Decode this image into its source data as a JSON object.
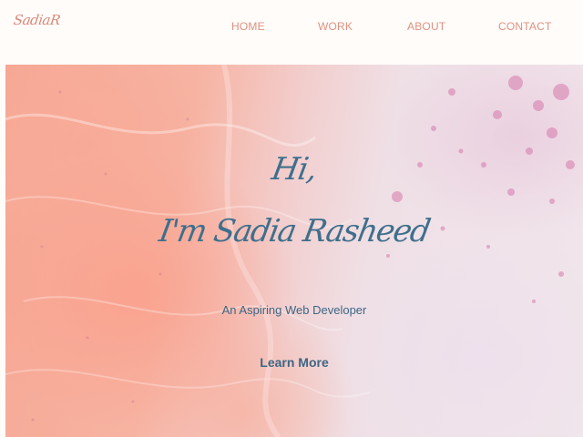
{
  "nav": {
    "logo": "SadiaR",
    "links": [
      "HOME",
      "WORK",
      "ABOUT",
      "CONTACT"
    ]
  },
  "hero": {
    "greeting": "Hi,",
    "name": "I'm Sadia Rasheed",
    "tagline": "An Aspiring Web Developer",
    "cta_label": "Learn More"
  },
  "colors": {
    "accent": "#e0917f",
    "heading": "#3f6f8c",
    "background": "#fffcfa"
  }
}
